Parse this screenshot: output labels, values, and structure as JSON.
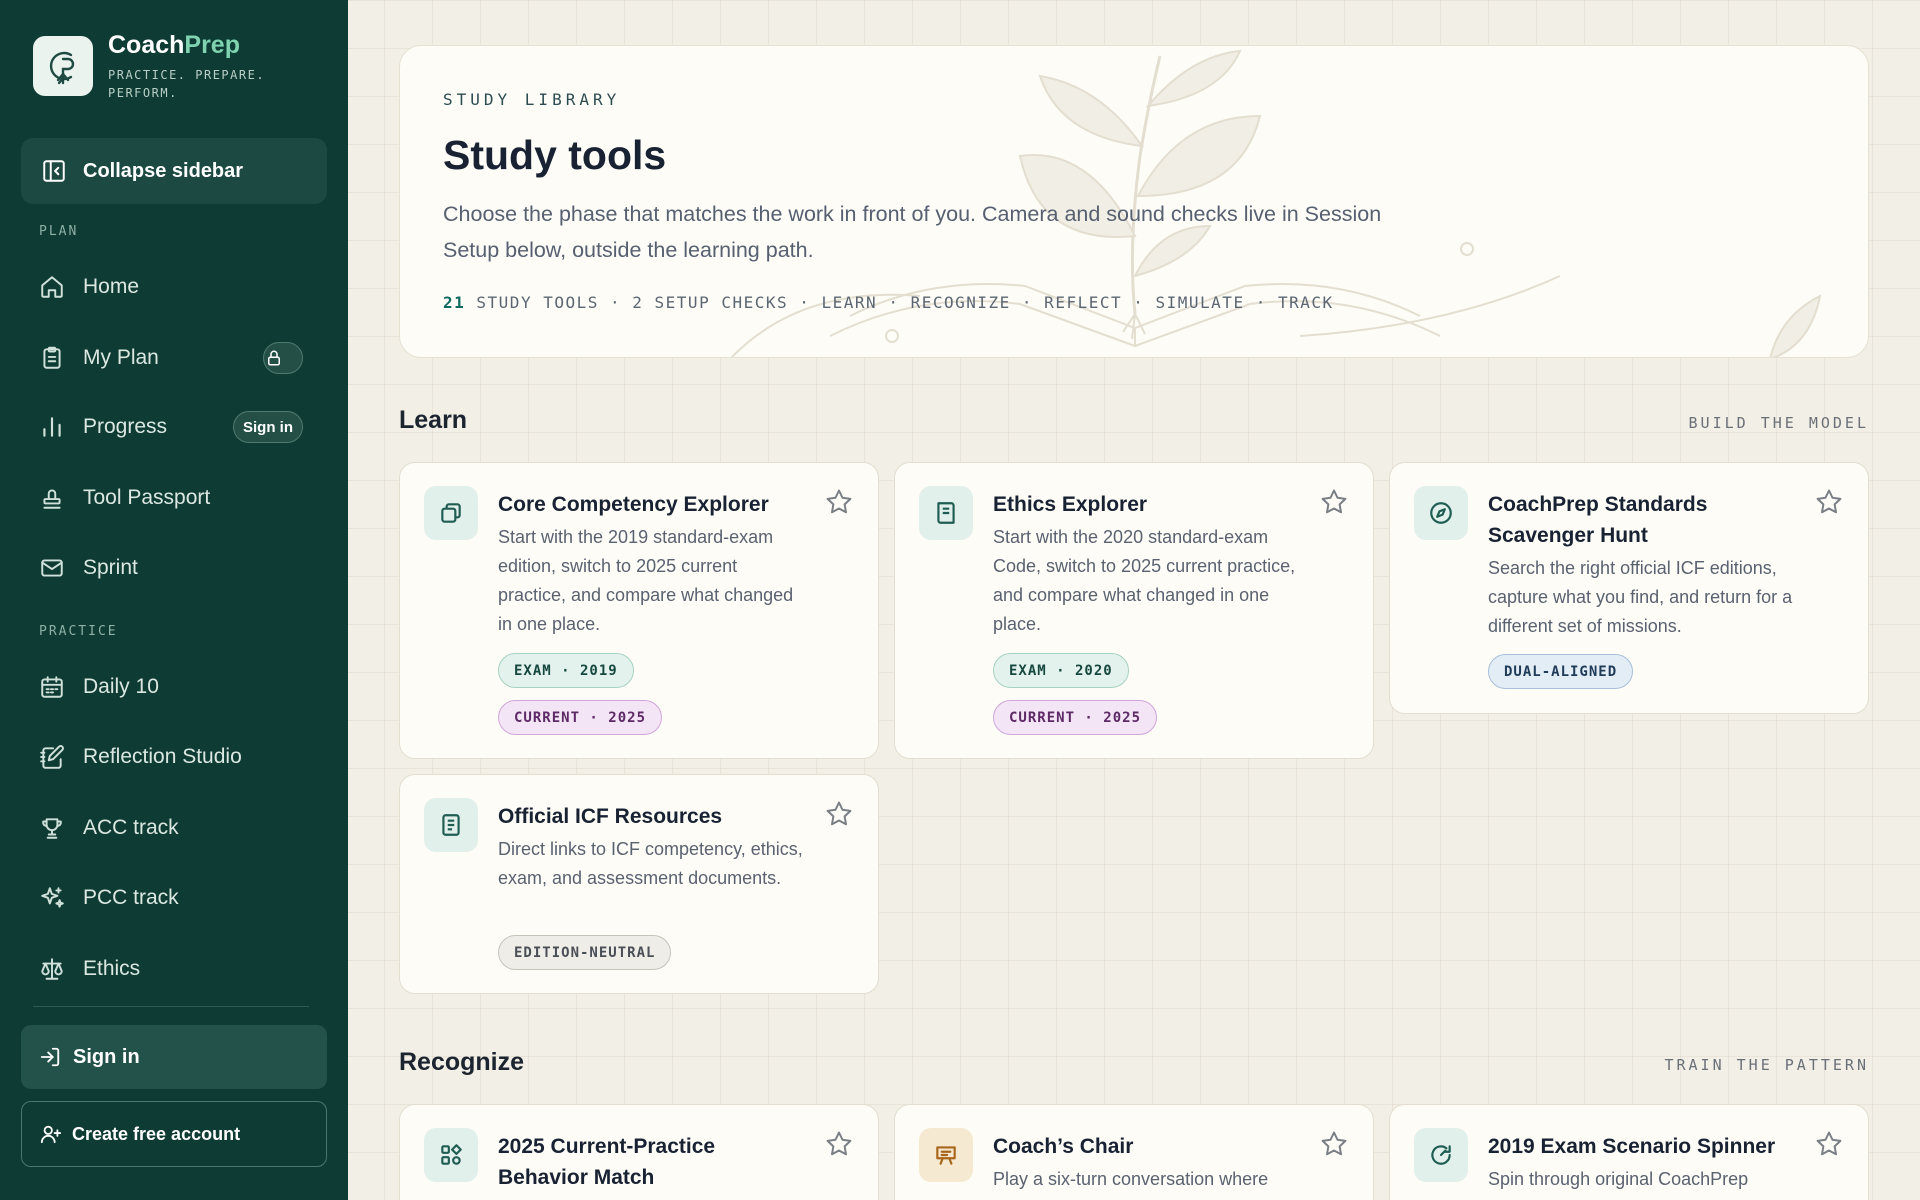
{
  "brand": {
    "name_part1": "Coach",
    "name_part2": "Prep",
    "tagline": "PRACTICE. PREPARE. PERFORM."
  },
  "sidebar": {
    "collapse_label": "Collapse sidebar",
    "section_plan": "PLAN",
    "section_practice": "PRACTICE",
    "items": [
      {
        "label": "Home",
        "icon": "home-icon"
      },
      {
        "label": "My Plan",
        "icon": "clipboard-icon",
        "badge": "lock-icon"
      },
      {
        "label": "Progress",
        "icon": "bar-chart-icon",
        "badge_text": "Sign in"
      },
      {
        "label": "Tool Passport",
        "icon": "stamp-icon"
      },
      {
        "label": "Sprint",
        "icon": "mail-icon"
      },
      {
        "label": "Daily 10",
        "icon": "calendar-icon"
      },
      {
        "label": "Reflection Studio",
        "icon": "notebook-pen-icon"
      },
      {
        "label": "ACC track",
        "icon": "trophy-icon"
      },
      {
        "label": "PCC track",
        "icon": "sparkles-icon"
      },
      {
        "label": "Ethics",
        "icon": "scale-icon"
      }
    ],
    "signin_label": "Sign in",
    "create_account_label": "Create free account"
  },
  "hero": {
    "eyebrow": "STUDY LIBRARY",
    "title": "Study tools",
    "description": "Choose the phase that matches the work in front of you. Camera and sound checks live in Session Setup below, outside the learning path.",
    "meta_count": "21",
    "meta_rest": "STUDY TOOLS · 2 SETUP CHECKS · LEARN · RECOGNIZE · REFLECT · SIMULATE · TRACK"
  },
  "sections": {
    "learn": {
      "title": "Learn",
      "kicker": "BUILD THE MODEL"
    },
    "recognize": {
      "title": "Recognize",
      "kicker": "TRAIN THE PATTERN"
    }
  },
  "learn_cards": [
    {
      "title": "Core Competency Explorer",
      "description": "Start with the 2019 standard-exam edition, switch to 2025 current practice, and compare what changed in one place.",
      "icon": "copy-icon",
      "tags": [
        "EXAM · 2019",
        "CURRENT · 2025"
      ]
    },
    {
      "title": "Ethics Explorer",
      "description": "Start with the 2020 standard-exam Code, switch to 2025 current practice, and compare what changed in one place.",
      "icon": "book-icon",
      "tags": [
        "EXAM · 2020",
        "CURRENT · 2025"
      ]
    },
    {
      "title": "CoachPrep Standards Scavenger Hunt",
      "description": "Search the right official ICF editions, capture what you find, and return for a different set of missions.",
      "icon": "compass-icon",
      "tags": [
        "DUAL-ALIGNED"
      ]
    },
    {
      "title": "Official ICF Resources",
      "description": "Direct links to ICF competency, ethics, exam, and assessment documents.",
      "icon": "document-icon",
      "tags": [
        "EDITION-NEUTRAL"
      ]
    }
  ],
  "recognize_cards": [
    {
      "title": "2025 Current-Practice Behavior Match",
      "description": "",
      "icon": "shapes-icon"
    },
    {
      "title": "Coach’s Chair",
      "description": "Play a six-turn conversation where",
      "icon": "presentation-icon"
    },
    {
      "title": "2019 Exam Scenario Spinner",
      "description": "Spin through original CoachPrep",
      "icon": "rotate-icon"
    }
  ],
  "colors": {
    "sidebar_bg": "#0e3b33",
    "accent_green": "#7fd3b0",
    "page_bg": "#f2efe6",
    "card_bg": "#fdfcf7"
  }
}
